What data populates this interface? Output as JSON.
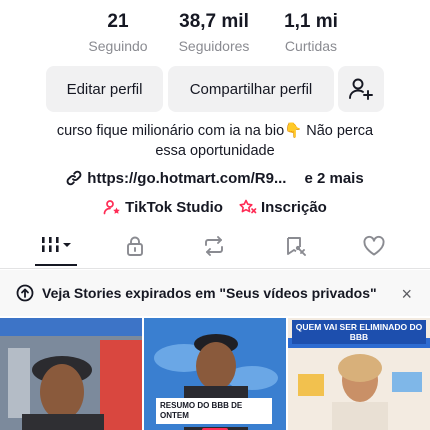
{
  "stats": {
    "following": {
      "value": "21",
      "label": "Seguindo"
    },
    "followers": {
      "value": "38,7 mil",
      "label": "Seguidores"
    },
    "likes": {
      "value": "1,1 mi",
      "label": "Curtidas"
    }
  },
  "actions": {
    "edit_label": "Editar perfil",
    "share_label": "Compartilhar perfil",
    "add_friend_icon": "add-user-icon"
  },
  "bio": {
    "line1": "curso fique milionário com ia na bio👇 Não perca",
    "line2": "essa oportunidade"
  },
  "link": {
    "url": "https://go.hotmart.com/R9...",
    "more": "e 2 mais"
  },
  "tools": {
    "studio_label": "TikTok Studio",
    "subscription_label": "Inscrição"
  },
  "tabs": [
    "videos-grid-icon",
    "lock-icon",
    "repost-icon",
    "favorites-icon",
    "heart-icon"
  ],
  "banner": {
    "text": "Veja Stories expirados em \"Seus vídeos privados\"",
    "close": "×"
  },
  "thumbnails": [
    {
      "caption": ""
    },
    {
      "caption_line1": "RESUMO DO BBB DE",
      "caption_line2": "ONTEM"
    },
    {
      "caption": "QUEM VAI SER ELIMINADO DO BBB"
    }
  ],
  "colors": {
    "text": "#161823",
    "muted": "#8a8b91",
    "button_bg": "#f1f1f2",
    "studio_accent": "#fe2c55"
  }
}
